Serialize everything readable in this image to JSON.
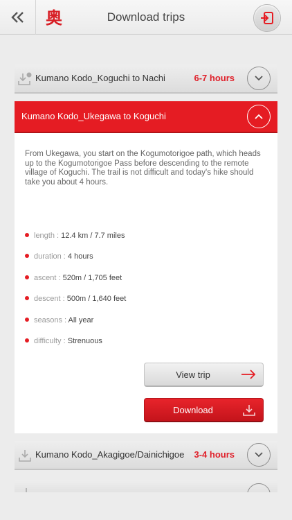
{
  "header": {
    "title": "Download trips",
    "logo_glyph": "奥",
    "back_icon": "double-chevron-left-icon",
    "exit_icon": "exit-icon"
  },
  "colors": {
    "accent": "#e51c23",
    "hours": "#e0202a",
    "background": "#ececec"
  },
  "trips": [
    {
      "name": "Kumano Kodo_Koguchi to Nachi",
      "hours": "6-7 hours"
    },
    {
      "name": "Kumano Kodo_Akagigoe/Dainichigoe",
      "hours": "3-4 hours"
    }
  ],
  "expanded": {
    "name": "Kumano Kodo_Ukegawa to Koguchi",
    "description": "From Ukegawa, you start on the Kogumotorigoe path, which heads up to the Kogumotorigoe Pass before descending to the remote village of Koguchi. The trail is not difficult and today's hike should take you about 4 hours.",
    "details": [
      {
        "key": "length : ",
        "value": "12.4 km / 7.7 miles"
      },
      {
        "key": "duration : ",
        "value": "4 hours"
      },
      {
        "key": "ascent : ",
        "value": "520m / 1,705 feet"
      },
      {
        "key": "descent : ",
        "value": "500m / 1,640 feet"
      },
      {
        "key": "seasons : ",
        "value": "All year"
      },
      {
        "key": "difficulty : ",
        "value": "Strenuous"
      }
    ],
    "view_label": "View trip",
    "download_label": "Download"
  }
}
